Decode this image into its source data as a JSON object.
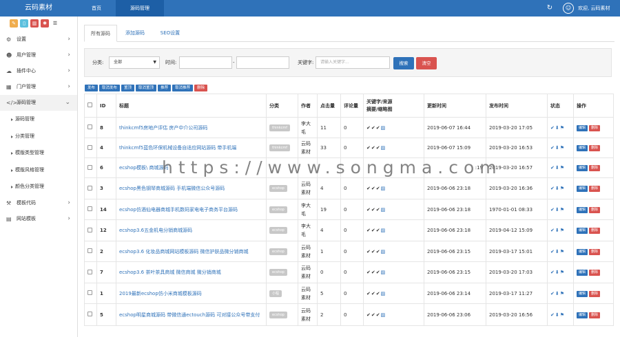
{
  "app": {
    "brand": "云码素材",
    "welcome": "欢迎, 云码素材",
    "top_nav": [
      "首页",
      "源码管理"
    ]
  },
  "sidebar": {
    "menu": [
      {
        "label": "设置",
        "icon": "gear-icon",
        "glyph": "⚙"
      },
      {
        "label": "用户管理",
        "icon": "users-icon",
        "glyph": "☻"
      },
      {
        "label": "插件中心",
        "icon": "cloud-icon",
        "glyph": "☁"
      },
      {
        "label": "门户管理",
        "icon": "grid-icon",
        "glyph": "▦"
      },
      {
        "label": "源码管理",
        "icon": "code-icon",
        "glyph": "</>"
      }
    ],
    "sub_items": [
      "源码管理",
      "分类管理",
      "模版类型管理",
      "模版风格管理",
      "颜色分类管理"
    ],
    "menu_after": [
      {
        "label": "模板代码",
        "icon": "hammer-icon",
        "glyph": "⚒"
      },
      {
        "label": "网站模板",
        "icon": "template-icon",
        "glyph": "▤"
      }
    ]
  },
  "tabs": [
    "所有源码",
    "添加源码",
    "SEO设置"
  ],
  "filter": {
    "category_label": "分类:",
    "category_value": "全部",
    "time_label": "时间:",
    "time_sep": "-",
    "keyword_label": "关键字:",
    "keyword_placeholder": "请输入关键字...",
    "search_btn": "搜索",
    "clear_btn": "清空"
  },
  "bulk_actions": [
    "发布",
    "取消发布",
    "置顶",
    "取消置顶",
    "推荐",
    "取消推荐",
    "删除"
  ],
  "table": {
    "headers": {
      "id": "ID",
      "title": "标题",
      "category": "分类",
      "author": "作者",
      "hits": "点击量",
      "comments": "评论量",
      "kw": "关键字/来源",
      "kw2": "摘要/缩略图",
      "updated": "更新时间",
      "published": "发布时间",
      "status": "状态",
      "ops": "操作"
    },
    "op_edit": "编辑",
    "op_delete": "删除",
    "rows": [
      {
        "id": "8",
        "title": "thinkcmf5房地产评估 房产中介公司源码",
        "category": "thinkcmf",
        "author": "李大毛",
        "hits": "11",
        "comments": "0",
        "updated": "2019-06-07 16:44",
        "published": "2019-03-20 17:05"
      },
      {
        "id": "4",
        "title": "thinkcmf5蓝色环保机械设备自适应网站源码 带手机端",
        "category": "thinkcmf",
        "author": "云码素材",
        "hits": "33",
        "comments": "0",
        "updated": "2019-06-07 15:09",
        "published": "2019-03-20 16:53"
      },
      {
        "id": "6",
        "title": "ecshop模板\\ 商城源码",
        "category": "",
        "author": "",
        "hits": "",
        "comments": "",
        "updated": ":19",
        "published": "2019-03-20 16:57"
      },
      {
        "id": "3",
        "title": "ecshop黑色钢琴商城源码 手机端微信公众号源码",
        "category": "ecshop",
        "author": "云码素材",
        "hits": "4",
        "comments": "0",
        "updated": "2019-06-06 23:18",
        "published": "2019-03-20 16:36"
      },
      {
        "id": "14",
        "title": "ecshop仿酒仙电器商城手机数码家电电子商务平台源码",
        "category": "ecshop",
        "author": "李大毛",
        "hits": "19",
        "comments": "0",
        "updated": "2019-06-06 23:18",
        "published": "1970-01-01 08:33"
      },
      {
        "id": "12",
        "title": "ecshop3.6五金机电分销商城源码",
        "category": "ecshop",
        "author": "李大毛",
        "hits": "4",
        "comments": "0",
        "updated": "2019-06-06 23:18",
        "published": "2019-04-12 15:09"
      },
      {
        "id": "2",
        "title": "ecshop3.6 化妆品商城网站模板源码 微信护肤品微分销商城",
        "category": "ecshop",
        "author": "云码素材",
        "hits": "1",
        "comments": "0",
        "updated": "2019-06-06 23:15",
        "published": "2019-03-17 15:01"
      },
      {
        "id": "7",
        "title": "ecshop3.6 茶叶茶具商城 微信商城 微分销商城",
        "category": "ecshop",
        "author": "云码素材",
        "hits": "0",
        "comments": "0",
        "updated": "2019-06-06 23:15",
        "published": "2019-03-20 17:03"
      },
      {
        "id": "1",
        "title": "2019最新ecshop仿小米商城模板源码",
        "category": "小程",
        "author": "云码素材",
        "hits": "5",
        "comments": "0",
        "updated": "2019-06-06 23:14",
        "published": "2019-03-17 11:27"
      },
      {
        "id": "5",
        "title": "ecshop明星商城源码 带微信通ectouch源码 可对接公众号带支付",
        "category": "ecshop",
        "author": "云码素材",
        "hits": "2",
        "comments": "0",
        "updated": "2019-06-06 23:06",
        "published": "2019-03-20 16:56"
      }
    ]
  },
  "watermark": "https://www.songma.com",
  "colors": {
    "primary": "#2f72b9",
    "danger": "#d9534f",
    "badge": "#c8c8c8"
  }
}
